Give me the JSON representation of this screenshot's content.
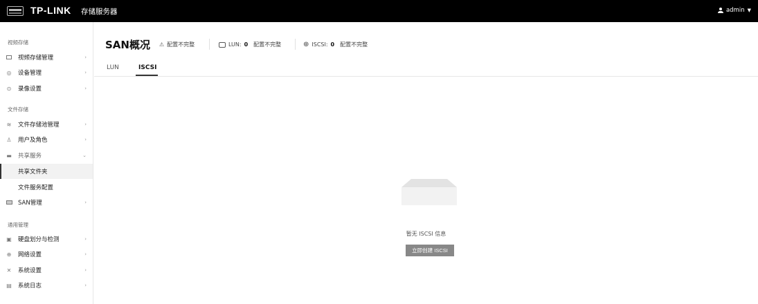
{
  "header": {
    "brand": "TP-LINK",
    "product": "存储服务器",
    "user": "admin"
  },
  "sidebar": {
    "sections": [
      {
        "title": "视频存储",
        "items": [
          {
            "label": "视频存储管理",
            "icon": "video-icon"
          },
          {
            "label": "设备管理",
            "icon": "camera-icon"
          },
          {
            "label": "录像设置",
            "icon": "record-icon"
          }
        ]
      },
      {
        "title": "文件存储",
        "items": [
          {
            "label": "文件存储池管理",
            "icon": "database-icon"
          },
          {
            "label": "用户及角色",
            "icon": "users-icon"
          },
          {
            "label": "共享服务",
            "icon": "folder-icon",
            "expanded": true,
            "children": [
              {
                "label": "共享文件夹",
                "active": true
              },
              {
                "label": "文件服务配置"
              }
            ]
          },
          {
            "label": "SAN管理",
            "icon": "san-icon"
          }
        ]
      },
      {
        "title": "通用管理",
        "items": [
          {
            "label": "硬盘划分与检测",
            "icon": "disk-icon"
          },
          {
            "label": "网络设置",
            "icon": "globe-icon"
          },
          {
            "label": "系统设置",
            "icon": "tools-icon"
          },
          {
            "label": "系统日志",
            "icon": "log-icon"
          }
        ]
      }
    ]
  },
  "main": {
    "title": "SAN概况",
    "status": [
      {
        "icon": "warning-icon",
        "prefix": "",
        "count": "",
        "text": "配置不完整"
      },
      {
        "icon": "lun-icon",
        "prefix": "LUN:",
        "count": "0",
        "text": "配置不完整"
      },
      {
        "icon": "globe-icon",
        "prefix": "ISCSI:",
        "count": "0",
        "text": "配置不完整"
      }
    ],
    "tabs": [
      {
        "label": "LUN"
      },
      {
        "label": "ISCSI",
        "active": true
      }
    ],
    "empty_text": "暂无 ISCSI 信息",
    "create_button": "立即创建 ISCSI"
  }
}
